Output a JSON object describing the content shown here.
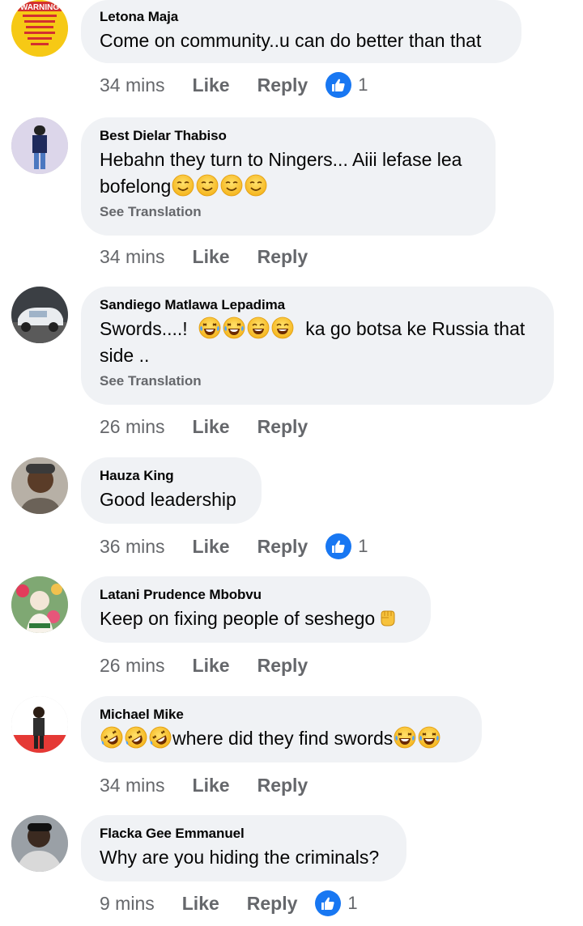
{
  "colors": {
    "bubble": "#f0f2f5",
    "meta": "#65676b",
    "like_blue": "#1877f2"
  },
  "comments": [
    {
      "name": "Letona Maja",
      "text": "Come on community..u can do better than that",
      "time": "34 mins",
      "like": "Like",
      "reply": "Reply",
      "reactions": "1",
      "avatar_icon": "warning-sign-avatar"
    },
    {
      "name": "Best Dielar Thabiso",
      "text_a": "Hebahn they turn to Ningers... Aiii lefase lea",
      "text_b": "bofelong",
      "translation": "See Translation",
      "time": "34 mins",
      "like": "Like",
      "reply": "Reply",
      "avatar_icon": "person-avatar"
    },
    {
      "name": "Sandiego Matlawa Lepadima",
      "text_a": "Swords....!",
      "text_b": "ka go botsa ke Russia that",
      "text_c": "side ..",
      "translation": "See Translation",
      "time": "26 mins",
      "like": "Like",
      "reply": "Reply",
      "avatar_icon": "car-avatar"
    },
    {
      "name": "Hauza King",
      "text": "Good leadership",
      "time": "36 mins",
      "like": "Like",
      "reply": "Reply",
      "reactions": "1",
      "avatar_icon": "face-avatar"
    },
    {
      "name": "Latani Prudence Mbobvu",
      "text": "Keep on fixing people of seshego",
      "time": "26 mins",
      "like": "Like",
      "reply": "Reply",
      "avatar_icon": "flowers-avatar"
    },
    {
      "name": "Michael Mike",
      "text": "where did they find swords",
      "time": "34 mins",
      "like": "Like",
      "reply": "Reply",
      "avatar_icon": "person-avatar"
    },
    {
      "name": "Flacka Gee Emmanuel",
      "text": "Why are you hiding the criminals?",
      "time": "9 mins",
      "like": "Like",
      "reply": "Reply",
      "reactions": "1",
      "avatar_icon": "face-avatar"
    }
  ]
}
